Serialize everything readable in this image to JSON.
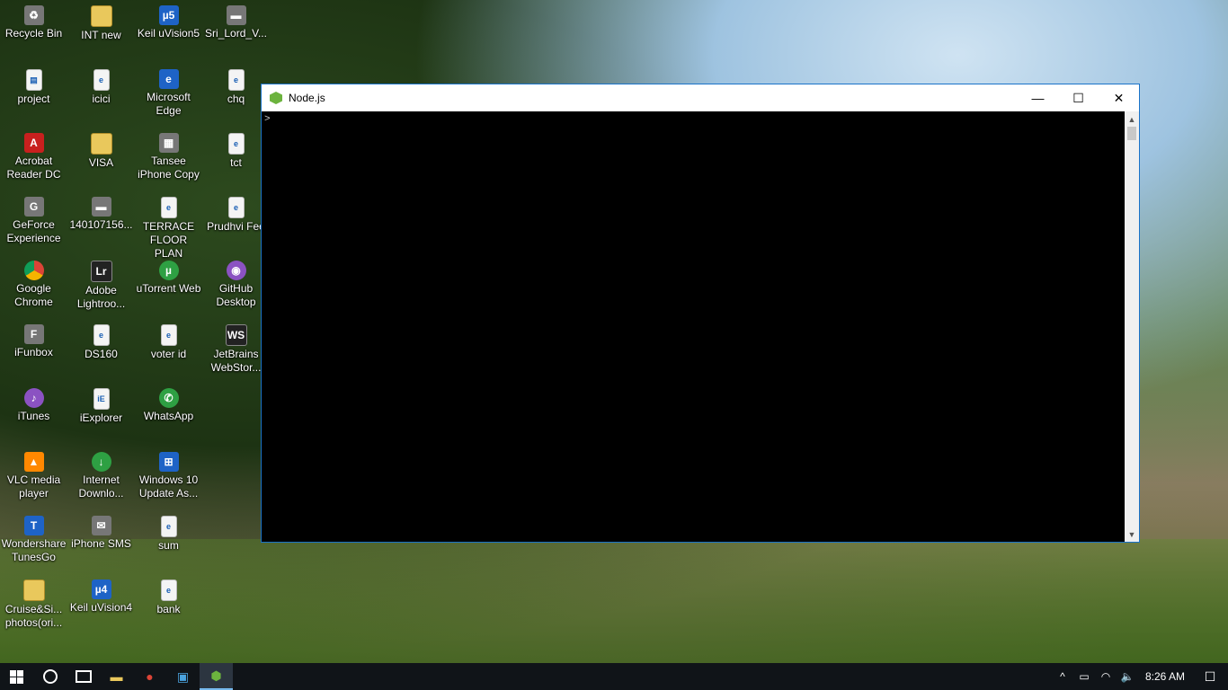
{
  "desktop": {
    "columns": [
      [
        {
          "label": "Recycle Bin",
          "icon": "recycle-bin-icon",
          "style": "gray",
          "glyph": "♻"
        },
        {
          "label": "project",
          "icon": "document-icon",
          "style": "doc",
          "glyph": "▤"
        },
        {
          "label": "Acrobat Reader DC",
          "icon": "acrobat-icon",
          "style": "red",
          "glyph": "A"
        },
        {
          "label": "GeForce Experience",
          "icon": "geforce-icon",
          "style": "gray",
          "glyph": "G"
        },
        {
          "label": "Google Chrome",
          "icon": "chrome-icon",
          "style": "chrome",
          "glyph": ""
        },
        {
          "label": "iFunbox",
          "icon": "ifunbox-icon",
          "style": "gray",
          "glyph": "F"
        },
        {
          "label": "iTunes",
          "icon": "itunes-icon",
          "style": "purple",
          "glyph": "♪"
        },
        {
          "label": "VLC media player",
          "icon": "vlc-icon",
          "style": "orange",
          "glyph": "▲"
        },
        {
          "label": "Wondershare TunesGo",
          "icon": "tunesgo-icon",
          "style": "shortcut-blue",
          "glyph": "T"
        },
        {
          "label": "Cruise&Si... photos(ori...",
          "icon": "folder-icon",
          "style": "folder",
          "glyph": ""
        }
      ],
      [
        {
          "label": "INT new",
          "icon": "folder-icon",
          "style": "folder",
          "glyph": ""
        },
        {
          "label": "icici",
          "icon": "pdf-document-icon",
          "style": "doc",
          "glyph": "e"
        },
        {
          "label": "VISA",
          "icon": "folder-icon",
          "style": "folder",
          "glyph": ""
        },
        {
          "label": "140107156...",
          "icon": "image-file-icon",
          "style": "gray",
          "glyph": "▬"
        },
        {
          "label": "Adobe Lightroo...",
          "icon": "lightroom-icon",
          "style": "dark",
          "glyph": "Lr"
        },
        {
          "label": "DS160",
          "icon": "pdf-document-icon",
          "style": "doc",
          "glyph": "e"
        },
        {
          "label": "iExplorer",
          "icon": "iexplorer-icon",
          "style": "doc",
          "glyph": "iE"
        },
        {
          "label": "Internet Downlo...",
          "icon": "internet-download-icon",
          "style": "green",
          "glyph": "↓"
        },
        {
          "label": "iPhone SMS",
          "icon": "iphone-sms-icon",
          "style": "gray",
          "glyph": "✉"
        },
        {
          "label": "Keil uVision4",
          "icon": "keil-icon",
          "style": "shortcut-blue",
          "glyph": "µ4"
        }
      ],
      [
        {
          "label": "Keil uVision5",
          "icon": "keil-icon",
          "style": "shortcut-blue",
          "glyph": "µ5"
        },
        {
          "label": "Microsoft Edge",
          "icon": "edge-icon",
          "style": "shortcut-blue",
          "glyph": "e"
        },
        {
          "label": "Tansee iPhone Copy",
          "icon": "tansee-icon",
          "style": "gray",
          "glyph": "▦"
        },
        {
          "label": "TERRACE FLOOR PLAN",
          "icon": "pdf-document-icon",
          "style": "doc",
          "glyph": "e"
        },
        {
          "label": "uTorrent Web",
          "icon": "utorrent-icon",
          "style": "green",
          "glyph": "µ"
        },
        {
          "label": "voter id",
          "icon": "pdf-document-icon",
          "style": "doc",
          "glyph": "e"
        },
        {
          "label": "WhatsApp",
          "icon": "whatsapp-icon",
          "style": "green",
          "glyph": "✆"
        },
        {
          "label": "Windows 10 Update As...",
          "icon": "windows-update-icon",
          "style": "shortcut-blue",
          "glyph": "⊞"
        },
        {
          "label": "sum",
          "icon": "pdf-document-icon",
          "style": "doc",
          "glyph": "e"
        },
        {
          "label": "bank",
          "icon": "pdf-document-icon",
          "style": "doc",
          "glyph": "e"
        }
      ],
      [
        {
          "label": "Sri_Lord_V...",
          "icon": "image-file-icon",
          "style": "gray",
          "glyph": "▬"
        },
        {
          "label": "chq",
          "icon": "pdf-document-icon",
          "style": "doc",
          "glyph": "e"
        },
        {
          "label": "tct",
          "icon": "pdf-document-icon",
          "style": "doc",
          "glyph": "e"
        },
        {
          "label": "Prudhvi Fee",
          "icon": "pdf-document-icon",
          "style": "doc",
          "glyph": "e"
        },
        {
          "label": "GitHub Desktop",
          "icon": "github-icon",
          "style": "purple",
          "glyph": "◉"
        },
        {
          "label": "JetBrains WebStor...",
          "icon": "webstorm-icon",
          "style": "dark",
          "glyph": "WS"
        }
      ]
    ]
  },
  "window": {
    "title": "Node.js",
    "minimize_glyph": "—",
    "maximize_glyph": "☐",
    "close_glyph": "✕",
    "prompt": ">"
  },
  "taskbar": {
    "pinned": [
      {
        "name": "file-explorer-icon",
        "glyph": "▬",
        "color": "#e9c85c",
        "active": false
      },
      {
        "name": "chrome-taskbar-icon",
        "glyph": "●",
        "color": "#db4437",
        "active": false
      },
      {
        "name": "control-panel-icon",
        "glyph": "▣",
        "color": "#4aa3df",
        "active": false
      },
      {
        "name": "nodejs-taskbar-icon",
        "glyph": "⬢",
        "color": "#6cb33e",
        "active": true
      }
    ],
    "tray": {
      "chevron": "^",
      "battery": "▭",
      "wifi": "◠",
      "volume": "🔈",
      "time": "8:26 AM",
      "notifications": "☐"
    }
  }
}
